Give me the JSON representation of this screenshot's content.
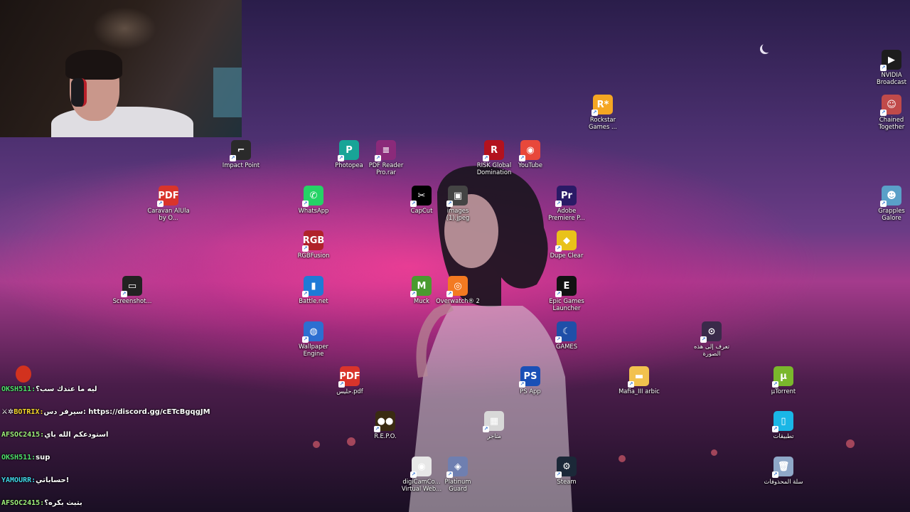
{
  "colors": {
    "chat_user_green": "#4ee06a",
    "chat_user_yellow": "#f5d82a",
    "chat_user_lightgreen": "#9ef07a",
    "chat_user_cyan": "#3fd6e6"
  },
  "icons": [
    {
      "id": "impact-point",
      "label": "Impact Point",
      "glyph": "⌐",
      "icon": "gun-icon",
      "bg": "#2a2a2a"
    },
    {
      "id": "photopea",
      "label": "Photopea",
      "glyph": "P",
      "icon": "photopea-icon",
      "bg": "#18a497"
    },
    {
      "id": "pdf-reader-rar",
      "label": "PDF Reader Pro.rar",
      "glyph": "≡",
      "icon": "winrar-archive-icon",
      "bg": "#8b2a7a"
    },
    {
      "id": "risk",
      "label": "RISK Global Domination",
      "glyph": "R",
      "icon": "risk-icon",
      "bg": "#b3121e"
    },
    {
      "id": "youtube",
      "label": "YouTube",
      "glyph": "◉",
      "icon": "chrome-icon",
      "bg": "#e8483b"
    },
    {
      "id": "rockstar",
      "label": "Rockstar Games ...",
      "glyph": "R*",
      "icon": "rockstar-icon",
      "bg": "#f5a623"
    },
    {
      "id": "nvidia",
      "label": "NVIDIA Broadcast",
      "glyph": "▶",
      "icon": "nvidia-broadcast-icon",
      "bg": "#1d1d1d"
    },
    {
      "id": "chained",
      "label": "Chained Together",
      "glyph": "☺",
      "icon": "chained-together-icon",
      "bg": "#c04a4a"
    },
    {
      "id": "caravan",
      "label": "Caravan AlUla by O...",
      "glyph": "PDF",
      "icon": "pdf-icon",
      "bg": "#d9342b"
    },
    {
      "id": "whatsapp",
      "label": "WhatsApp",
      "glyph": "✆",
      "icon": "whatsapp-icon",
      "bg": "#25d366"
    },
    {
      "id": "capcut",
      "label": "CapCut",
      "glyph": "✂",
      "icon": "capcut-icon",
      "bg": "#000000"
    },
    {
      "id": "images",
      "label": "images (1).jpeg",
      "glyph": "▣",
      "icon": "image-file-icon",
      "bg": "#444444"
    },
    {
      "id": "premiere",
      "label": "Adobe Premiere P...",
      "glyph": "Pr",
      "icon": "premiere-icon",
      "bg": "#2a1a66"
    },
    {
      "id": "grapples",
      "label": "Grapples Galore",
      "glyph": "☻",
      "icon": "grapples-galore-icon",
      "bg": "#5aa0c8"
    },
    {
      "id": "rgbfusion",
      "label": "RGBFusion",
      "glyph": "RGB",
      "icon": "rgbfusion-icon",
      "bg": "#b0232a"
    },
    {
      "id": "dupe-clear",
      "label": "Dupe Clear",
      "glyph": "◆",
      "icon": "dupe-clear-icon",
      "bg": "#e9c21a"
    },
    {
      "id": "screenshot",
      "label": "Screenshot...",
      "glyph": "▭",
      "icon": "screenshot-file-icon",
      "bg": "#222222"
    },
    {
      "id": "battlenet",
      "label": "Battle.net",
      "glyph": "▮",
      "icon": "battlenet-icon",
      "bg": "#1f7ad6"
    },
    {
      "id": "muck",
      "label": "Muck",
      "glyph": "M",
      "icon": "muck-icon",
      "bg": "#4a9b2f"
    },
    {
      "id": "overwatch",
      "label": "Overwatch® 2",
      "glyph": "◎",
      "icon": "overwatch-icon",
      "bg": "#f37a21"
    },
    {
      "id": "epic",
      "label": "Epic Games Launcher",
      "glyph": "E",
      "icon": "epic-games-icon",
      "bg": "#121212"
    },
    {
      "id": "wallpaper-engine",
      "label": "Wallpaper Engine",
      "glyph": "◍",
      "icon": "wallpaper-engine-icon",
      "bg": "#2d6fd1"
    },
    {
      "id": "games",
      "label": "GAMES",
      "glyph": "☾",
      "icon": "games-folder-icon",
      "bg": "#1f4fa8"
    },
    {
      "id": "learn-about-picture",
      "label": "تعرف إلى هذه الصورة",
      "glyph": "⊙",
      "icon": "spotlight-camera-icon",
      "bg": "#3a2a4a"
    },
    {
      "id": "chalice-pdf",
      "label": "حليس.pdf",
      "glyph": "PDF",
      "icon": "pdf-icon",
      "bg": "#d9342b"
    },
    {
      "id": "ps-app",
      "label": "PS App",
      "glyph": "PS",
      "icon": "playstation-icon",
      "bg": "#1a50b6"
    },
    {
      "id": "mafia",
      "label": "Mafia_III arbic",
      "glyph": "▬",
      "icon": "folder-icon",
      "bg": "#f2c14e"
    },
    {
      "id": "utorrent",
      "label": "µTorrent",
      "glyph": "µ",
      "icon": "utorrent-icon",
      "bg": "#7ab72c"
    },
    {
      "id": "repo",
      "label": "R.E.P.O.",
      "glyph": "●●",
      "icon": "repo-game-icon",
      "bg": "#3a2b12"
    },
    {
      "id": "stores",
      "label": "متاجر",
      "glyph": "▦",
      "icon": "stores-icon",
      "bg": "#d8d8d8"
    },
    {
      "id": "apps",
      "label": "تطبيقات",
      "glyph": "▯",
      "icon": "apps-phone-icon",
      "bg": "#1ab6e6"
    },
    {
      "id": "digicam",
      "label": "digiCamCo... Virtual Web...",
      "glyph": "◉",
      "icon": "digicam-webcam-icon",
      "bg": "#e7e7e7"
    },
    {
      "id": "platinum-guard",
      "label": "Platinum Guard",
      "glyph": "◈",
      "icon": "platinum-guard-icon",
      "bg": "#6f7fb0"
    },
    {
      "id": "steam",
      "label": "Steam",
      "glyph": "⚙",
      "icon": "steam-icon",
      "bg": "#1b2838"
    },
    {
      "id": "recycle-bin",
      "label": "سلة المحذوفات",
      "glyph": "🗑",
      "icon": "recycle-bin-icon",
      "bg": "#8fa8c8"
    }
  ],
  "chat": {
    "messages": [
      {
        "user": "OKSH511:",
        "text": "ليه ما عندك سب؟",
        "color": "#4ee06a"
      },
      {
        "user": "BOTRIX:",
        "text": "سيرفر دس: https://discord.gg/cETcBgqgJM",
        "color": "#f5d82a",
        "prefix": "⚔✲"
      },
      {
        "user": "AFSOC2415:",
        "text": "استودعكم الله باي",
        "color": "#9ef07a"
      },
      {
        "user": "OKSH511:",
        "text": "sup",
        "color": "#4ee06a"
      },
      {
        "user": "YAMOURR:",
        "text": "حساباتي!",
        "color": "#3fd6e6"
      },
      {
        "user": "AFSOC2415:",
        "text": "بتبث بكره؟",
        "color": "#9ef07a"
      }
    ]
  }
}
